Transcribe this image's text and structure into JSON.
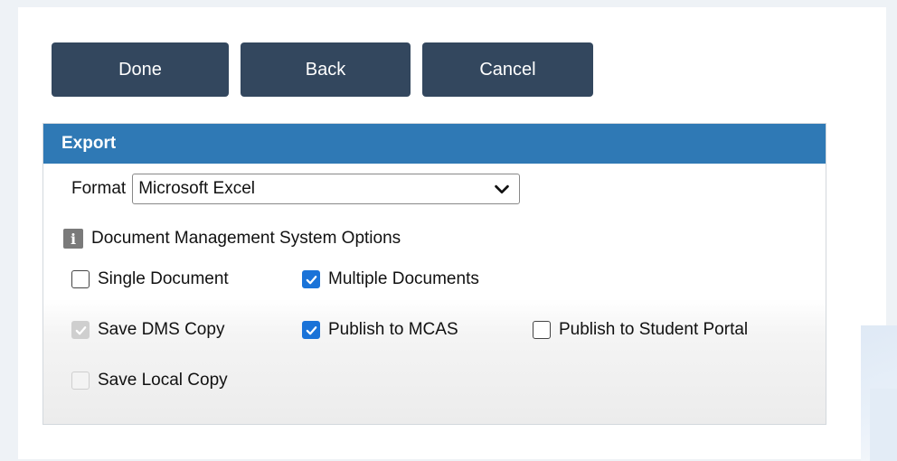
{
  "toolbar": {
    "done_label": "Done",
    "back_label": "Back",
    "cancel_label": "Cancel"
  },
  "export": {
    "header": "Export",
    "format_label": "Format",
    "format_value": "Microsoft Excel",
    "dms_title": "Document Management System Options",
    "options": {
      "single_document": {
        "label": "Single Document",
        "checked": false,
        "disabled": false
      },
      "multiple_documents": {
        "label": "Multiple Documents",
        "checked": true,
        "disabled": false
      },
      "save_dms_copy": {
        "label": "Save DMS Copy",
        "checked": true,
        "disabled": true
      },
      "publish_mcas": {
        "label": "Publish to MCAS",
        "checked": true,
        "disabled": false
      },
      "publish_student_portal": {
        "label": "Publish to Student Portal",
        "checked": false,
        "disabled": false
      },
      "save_local_copy": {
        "label": "Save Local Copy",
        "checked": false,
        "disabled": true
      }
    }
  },
  "colors": {
    "button_bg": "#33475e",
    "header_bg": "#2f79b5",
    "checkbox_checked": "#1a73d8",
    "checkbox_disabled": "#cfcfcf"
  },
  "icons": {
    "info": "info-icon",
    "chevron": "chevron-down-icon",
    "check": "checkmark-icon"
  }
}
